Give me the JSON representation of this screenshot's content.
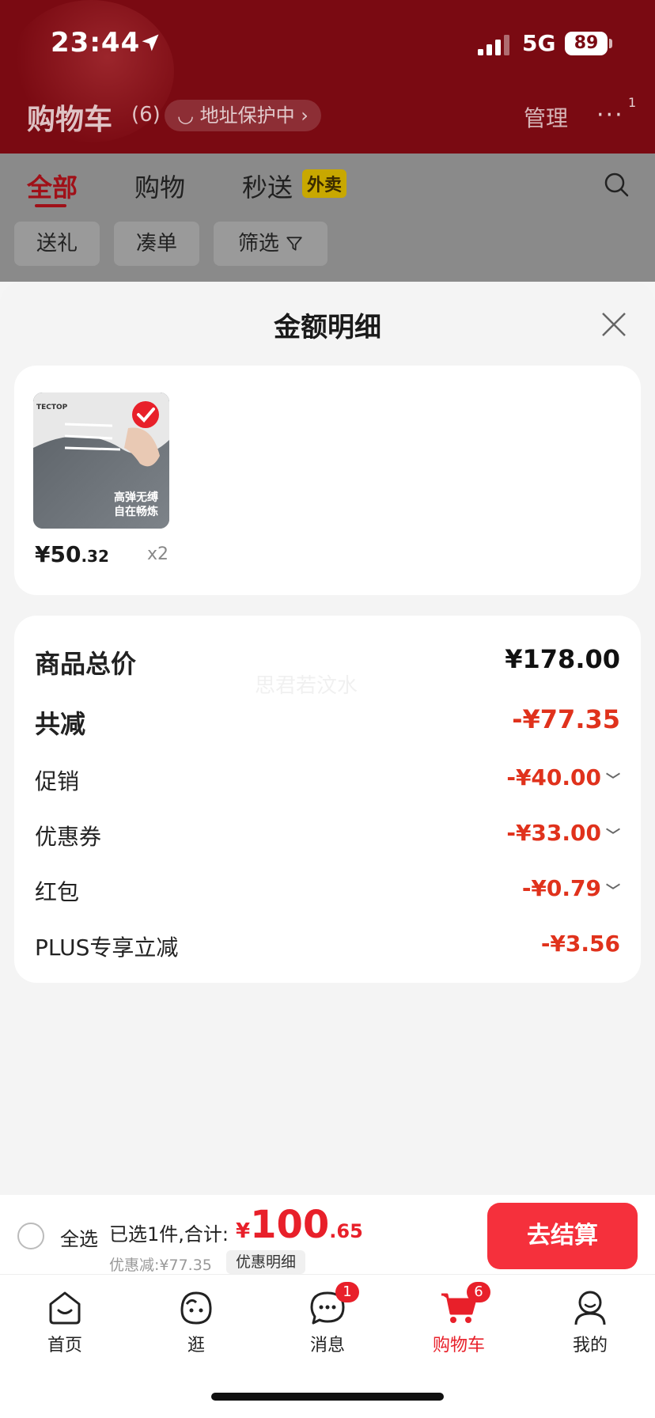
{
  "status_bar": {
    "time": "23:44",
    "network": "5G",
    "battery": "89"
  },
  "header": {
    "title": "购物车",
    "count": "(6)",
    "address_protection": "地址保护中 ›",
    "manage": "管理",
    "more": "···",
    "more_badge": "1"
  },
  "tabs": [
    {
      "label": "全部"
    },
    {
      "label": "购物"
    },
    {
      "label": "秒送",
      "badge": "外卖"
    }
  ],
  "filters": [
    {
      "label": "送礼"
    },
    {
      "label": "凑单"
    },
    {
      "label": "筛选"
    }
  ],
  "sheet": {
    "title": "金额明细",
    "product": {
      "brand": "TECTOP",
      "image_caption_1": "高弹无缚",
      "image_caption_2": "自在畅炼",
      "price_main": "¥50",
      "price_cents": ".32",
      "quantity": "x2"
    },
    "summary": [
      {
        "label": "商品总价",
        "value": "¥178.00"
      },
      {
        "label": "共减",
        "value": "-¥77.35"
      }
    ],
    "breakdown": [
      {
        "label": "促销",
        "value": "-¥40.00"
      },
      {
        "label": "优惠券",
        "value": "-¥33.00"
      },
      {
        "label": "红包",
        "value": "-¥0.79"
      },
      {
        "label": "PLUS专享立减",
        "value": "-¥3.56"
      }
    ],
    "watermark": "思君若汶水"
  },
  "bottom_bar": {
    "select_all": "全选",
    "selected_info": "已选1件,合计:",
    "total_yen": "¥",
    "total_main": "100",
    "total_cents": ".65",
    "discount": "优惠减:¥77.35",
    "detail": "优惠明细",
    "checkout": "去结算"
  },
  "nav": [
    {
      "label": "首页",
      "icon": "home-icon"
    },
    {
      "label": "逛",
      "icon": "browse-icon"
    },
    {
      "label": "消息",
      "icon": "message-icon",
      "badge": "1"
    },
    {
      "label": "购物车",
      "icon": "cart-icon",
      "badge": "6"
    },
    {
      "label": "我的",
      "icon": "profile-icon"
    }
  ],
  "colors": {
    "accent": "#e8202a",
    "header_bg": "#7a0a12",
    "discount_red": "#e0321c"
  }
}
